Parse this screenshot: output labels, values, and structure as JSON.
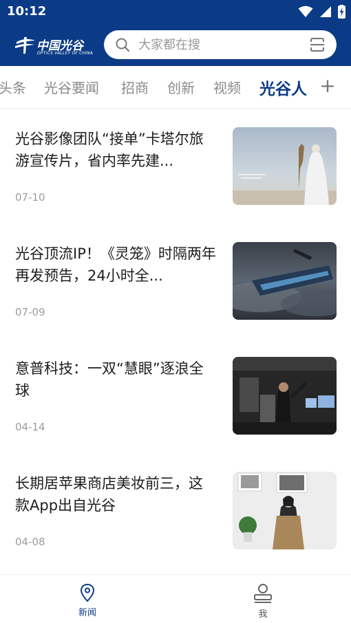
{
  "status_bar": {
    "time": "10:12",
    "icons": [
      "wifi-icon",
      "signal-icon",
      "battery-charging-icon"
    ]
  },
  "header": {
    "logo": {
      "cn": "中国光谷",
      "en": "OPTICS VALLEY OF CHINA"
    },
    "search": {
      "placeholder": "大家都在搜"
    },
    "colors": {
      "brand": "#0b3b86"
    }
  },
  "tabs": {
    "items": [
      {
        "label": "头条",
        "active": false
      },
      {
        "label": "光谷要闻",
        "active": false
      },
      {
        "label": "招商",
        "active": false
      },
      {
        "label": "创新",
        "active": false
      },
      {
        "label": "视频",
        "active": false
      },
      {
        "label": "光谷人",
        "active": true
      }
    ],
    "add_label": "+"
  },
  "news": [
    {
      "title": "光谷影像团队“接单”卡塔尔旅游宣传片，省内率先建...",
      "date": "07-10"
    },
    {
      "title": "光谷顶流IP！《灵笼》时隔两年再发预告，24小时全...",
      "date": "07-09"
    },
    {
      "title": "意普科技：一双“慧眼”逐浪全球",
      "date": "04-14"
    },
    {
      "title": "长期居苹果商店美妆前三，这款App出自光谷",
      "date": "04-08"
    }
  ],
  "bottom_nav": [
    {
      "label": "新闻",
      "icon": "location-pin-icon",
      "active": true
    },
    {
      "label": "我",
      "icon": "user-icon",
      "active": false
    }
  ]
}
